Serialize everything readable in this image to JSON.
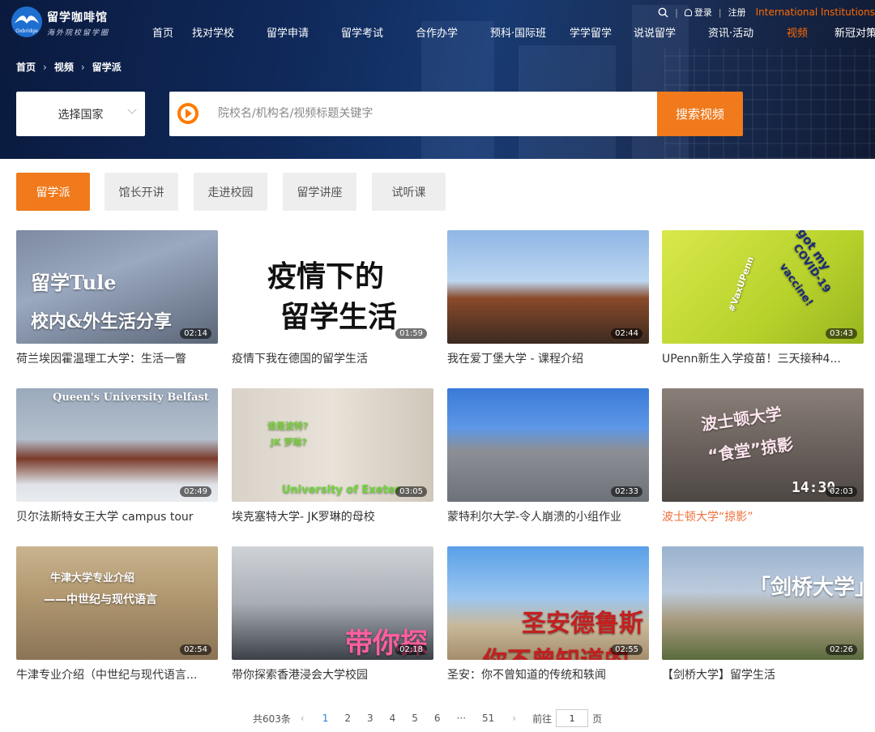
{
  "brand": {
    "logo_sub": "Oxbridge",
    "name": "留学咖啡馆",
    "slogan": "海外院校留学圈",
    "colors": {
      "accent": "#f07a1c",
      "nav_active": "#ff6a00",
      "link_blue": "#2b7de0",
      "hero_bg": "#102a5c"
    }
  },
  "util": {
    "login": "登录",
    "register": "注册",
    "international": "International Institutions"
  },
  "nav": [
    "首页",
    "找对学校",
    "留学申请",
    "留学考试",
    "合作办学",
    "预科·国际班",
    "学学留学",
    "说说留学",
    "资讯·活动",
    "视频",
    "新冠对策"
  ],
  "nav_active": "视频",
  "breadcrumb": [
    "首页",
    "视频",
    "留学派"
  ],
  "search": {
    "country_label": "选择国家",
    "placeholder": "院校名/机构名/视频标题关键字",
    "button": "搜索视频"
  },
  "tabs": [
    "留学派",
    "馆长开讲",
    "走进校园",
    "留学讲座",
    "试听课"
  ],
  "active_tab": "留学派",
  "videos": [
    {
      "title": "荷兰埃因霍温理工大学：生活一瞥",
      "duration": "02:14",
      "overlay": [
        "留学Tule",
        "校内&外生活分享"
      ],
      "bg": "linear-gradient(160deg,#7d8aa0 0%,#9aa8c0 40%,#5b6677 100%)"
    },
    {
      "title": "疫情下我在德国的留学生活",
      "duration": "01:59",
      "overlay": [
        "疫情下的",
        "留学生活"
      ],
      "bg": "#ffffff"
    },
    {
      "title": "我在爱丁堡大学 - 课程介绍",
      "duration": "02:44",
      "overlay": [],
      "bg": "linear-gradient(180deg,#8fb6e6 0%,#bcd6f0 45%,#8a4a2a 60%,#3b2a20 100%)"
    },
    {
      "title": "UPenn新生入学疫苗！三天接种4...",
      "duration": "03:43",
      "overlay": [
        "I got my",
        "COVID-19",
        "vaccine!",
        "#VaxUPenn"
      ],
      "bg": "linear-gradient(135deg,#d9e84b 0%,#b8d22c 60%,#97b51f 100%)"
    },
    {
      "title": "贝尔法斯特女王大学 campus tour",
      "duration": "02:49",
      "overlay": [
        "Queen's University Belfast"
      ],
      "bg": "linear-gradient(180deg,#9aa9bc 0%,#b3bfcc 45%,#7a3a2a 62%,#dfe3e8 85%,#e9ecef 100%)"
    },
    {
      "title": "埃克塞特大学- JK罗琳的母校",
      "duration": "03:05",
      "overlay": [
        "谁是波特?",
        "JK 罗琳?",
        "University of Exeter"
      ],
      "bg": "linear-gradient(90deg,#d8d2c8 0%,#e8e2d8 50%,#cfc7ba 100%)"
    },
    {
      "title": "蒙特利尔大学-令人崩溃的小组作业",
      "duration": "02:33",
      "overlay": [],
      "bg": "linear-gradient(180deg,#3a7ad8 0%,#5d97e6 35%,#8c8f95 55%,#6d7278 100%)"
    },
    {
      "title": "波士顿大学“掠影”",
      "duration": "02:03",
      "overlay": [
        "波士顿大学",
        "“食堂”掠影",
        "14:30"
      ],
      "bg": "linear-gradient(180deg,#8a7f78 0%,#6b625d 50%,#4d4743 100%)"
    },
    {
      "title": "牛津专业介绍（中世纪与现代语言...",
      "duration": "02:54",
      "overlay": [
        "牛津大学专业介绍",
        "——中世纪与现代语言"
      ],
      "bg": "linear-gradient(180deg,#c9b48f 0%,#b39a72 40%,#8a7456 100%)"
    },
    {
      "title": "带你探索香港浸会大学校园",
      "duration": "02:18",
      "overlay": [
        "带你探"
      ],
      "bg": "linear-gradient(180deg,#cfd3d8 0%,#a9aeb5 50%,#3c4147 100%)"
    },
    {
      "title": "圣安：你不曾知道的传统和轶闻",
      "duration": "02:55",
      "overlay": [
        "圣安德鲁斯",
        "你不曾知道的"
      ],
      "bg": "linear-gradient(180deg,#5aa0e8 0%,#9bc6f0 45%,#c8b89a 70%,#a48d6b 100%)"
    },
    {
      "title": "【剑桥大学】留学生活",
      "duration": "02:26",
      "overlay": [
        "「剑桥大学」"
      ],
      "bg": "linear-gradient(180deg,#9ab3cf 0%,#bccbdc 40%,#a89a7e 65%,#5a6b3c 100%)"
    }
  ],
  "pager": {
    "total": "共603条",
    "pages": [
      "1",
      "2",
      "3",
      "4",
      "5",
      "6",
      "···",
      "51"
    ],
    "current": "1",
    "goto_prefix": "前往",
    "goto_value": "1",
    "goto_suffix": "页"
  }
}
